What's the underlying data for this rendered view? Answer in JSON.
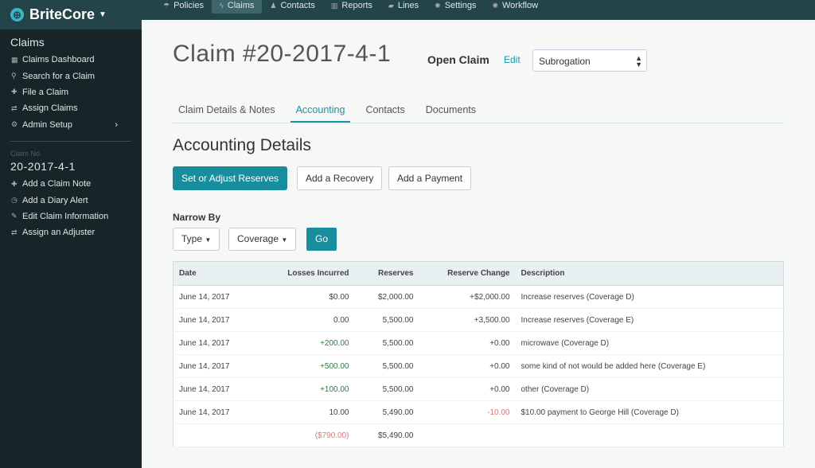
{
  "brand": {
    "name": "BriteCore"
  },
  "nav": [
    {
      "label": "Policies",
      "icon": "umbrella-icon"
    },
    {
      "label": "Claims",
      "icon": "bolt-icon",
      "active": true
    },
    {
      "label": "Contacts",
      "icon": "person-icon"
    },
    {
      "label": "Reports",
      "icon": "bar-chart-icon"
    },
    {
      "label": "Lines",
      "icon": "book-icon"
    },
    {
      "label": "Settings",
      "icon": "gear-icon"
    },
    {
      "label": "Workflow",
      "icon": "gear-icon"
    }
  ],
  "sidebar": {
    "title": "Claims",
    "items": [
      {
        "label": "Claims Dashboard"
      },
      {
        "label": "Search for a Claim"
      },
      {
        "label": "File a Claim"
      },
      {
        "label": "Assign Claims"
      },
      {
        "label": "Admin Setup"
      }
    ],
    "claim_label": "Claim No.",
    "claim_no": "20-2017-4-1",
    "claim_items": [
      {
        "label": "Add a Claim Note"
      },
      {
        "label": "Add a Diary Alert"
      },
      {
        "label": "Edit Claim Information"
      },
      {
        "label": "Assign an Adjuster"
      }
    ]
  },
  "header": {
    "title": "Claim #20-2017-4-1",
    "status": "Open Claim",
    "edit": "Edit",
    "select_value": "Subrogation"
  },
  "tabs": [
    "Claim Details & Notes",
    "Accounting",
    "Contacts",
    "Documents"
  ],
  "section": {
    "title": "Accounting Details",
    "buttons": [
      "Set or Adjust Reserves",
      "Add a Recovery",
      "Add a Payment"
    ],
    "narrow_by": "Narrow By",
    "filters": [
      "Type",
      "Coverage"
    ],
    "go": "Go"
  },
  "table": {
    "headers": [
      "Date",
      "Losses Incurred",
      "Reserves",
      "Reserve Change",
      "Description"
    ],
    "rows": [
      [
        "June 14, 2017",
        "$0.00",
        "$2,000.00",
        "+$2,000.00",
        "Increase reserves (Coverage D)"
      ],
      [
        "June 14, 2017",
        "0.00",
        "5,500.00",
        "+3,500.00",
        "Increase reserves (Coverage E)"
      ],
      [
        "June 14, 2017",
        "+200.00",
        "5,500.00",
        "+0.00",
        "microwave (Coverage D)"
      ],
      [
        "June 14, 2017",
        "+500.00",
        "5,500.00",
        "+0.00",
        "some kind of not would be added here (Coverage E)"
      ],
      [
        "June 14, 2017",
        "+100.00",
        "5,500.00",
        "+0.00",
        "other (Coverage D)"
      ],
      [
        "June 14, 2017",
        "10.00",
        "5,490.00",
        "-10.00",
        "$10.00 payment to George Hill (Coverage D)"
      ]
    ],
    "totals": [
      "($790.00)",
      "$5,490.00"
    ]
  },
  "colors": {
    "accent": "#178d9d",
    "positive": "#2c7a46",
    "negative": "#d9777a"
  }
}
